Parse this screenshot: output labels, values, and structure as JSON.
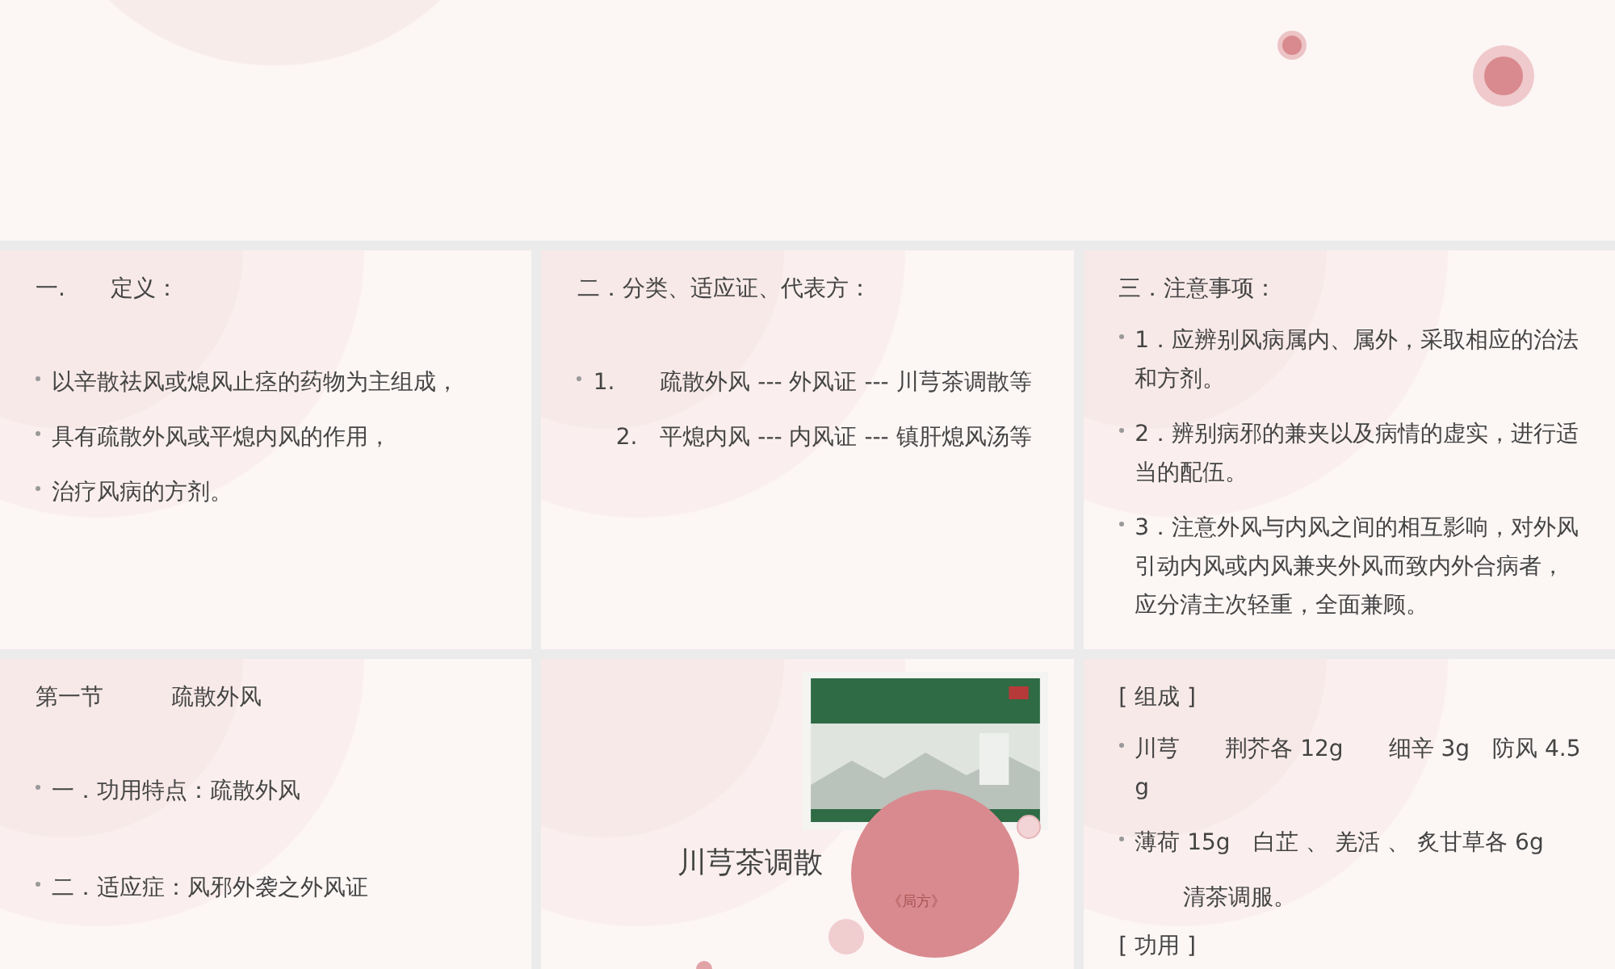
{
  "slides": [
    {
      "kind": "blank"
    },
    {
      "kind": "text",
      "lines": [
        {
          "kind": "title",
          "text": "一.　　定义："
        },
        {
          "kind": "gap"
        },
        {
          "kind": "bullet",
          "text": "以辛散祛风或熄风止痉的药物为主组成，"
        },
        {
          "kind": "bullet",
          "text": "具有疏散外风或平熄内风的作用，"
        },
        {
          "kind": "bullet",
          "text": "治疗风病的方剂。"
        }
      ]
    },
    {
      "kind": "text",
      "lines": [
        {
          "kind": "title",
          "text": "二．分类、适应证、代表方："
        },
        {
          "kind": "gap"
        },
        {
          "kind": "bullet",
          "text": "1.　　疏散外风 --- 外风证 --- 川芎茶调散等"
        },
        {
          "kind": "plain",
          "text": "　2.　平熄内风 --- 内风证 --- 镇肝熄风汤等"
        }
      ]
    },
    {
      "kind": "text",
      "lines": [
        {
          "kind": "title",
          "text": "三．注意事项："
        },
        {
          "kind": "bullet",
          "text": "1．应辨别风病属内、属外，采取相应的治法和方剂。"
        },
        {
          "kind": "bullet",
          "text": "2．辨别病邪的兼夹以及病情的虚实，进行适当的配伍。"
        },
        {
          "kind": "bullet",
          "text": "3．注意外风与内风之间的相互影响，对外风引动内风或内风兼夹外风而致内外合病者，应分清主次轻重，全面兼顾。"
        }
      ]
    },
    {
      "kind": "text",
      "lines": [
        {
          "kind": "title",
          "text": "第一节　　　疏散外风"
        },
        {
          "kind": "gap"
        },
        {
          "kind": "bullet",
          "text": "一．功用特点：疏散外风"
        },
        {
          "kind": "gap"
        },
        {
          "kind": "bullet",
          "text": "二．适应症：风邪外袭之外风证"
        }
      ]
    },
    {
      "kind": "cover",
      "title": "川芎茶调散",
      "source": "《局方》"
    },
    {
      "kind": "text",
      "lines": [
        {
          "kind": "title",
          "text": "[ 组成 ]"
        },
        {
          "kind": "bullet",
          "text": "川芎　　荆芥各 12g　　细辛 3g　防风 4.5 g"
        },
        {
          "kind": "bullet",
          "text": "薄荷 15g　白芷 、 羌活 、 炙甘草各 6g"
        },
        {
          "kind": "indent",
          "text": "清茶调服。"
        },
        {
          "kind": "title",
          "text": "[ 功用 ]"
        }
      ]
    }
  ]
}
